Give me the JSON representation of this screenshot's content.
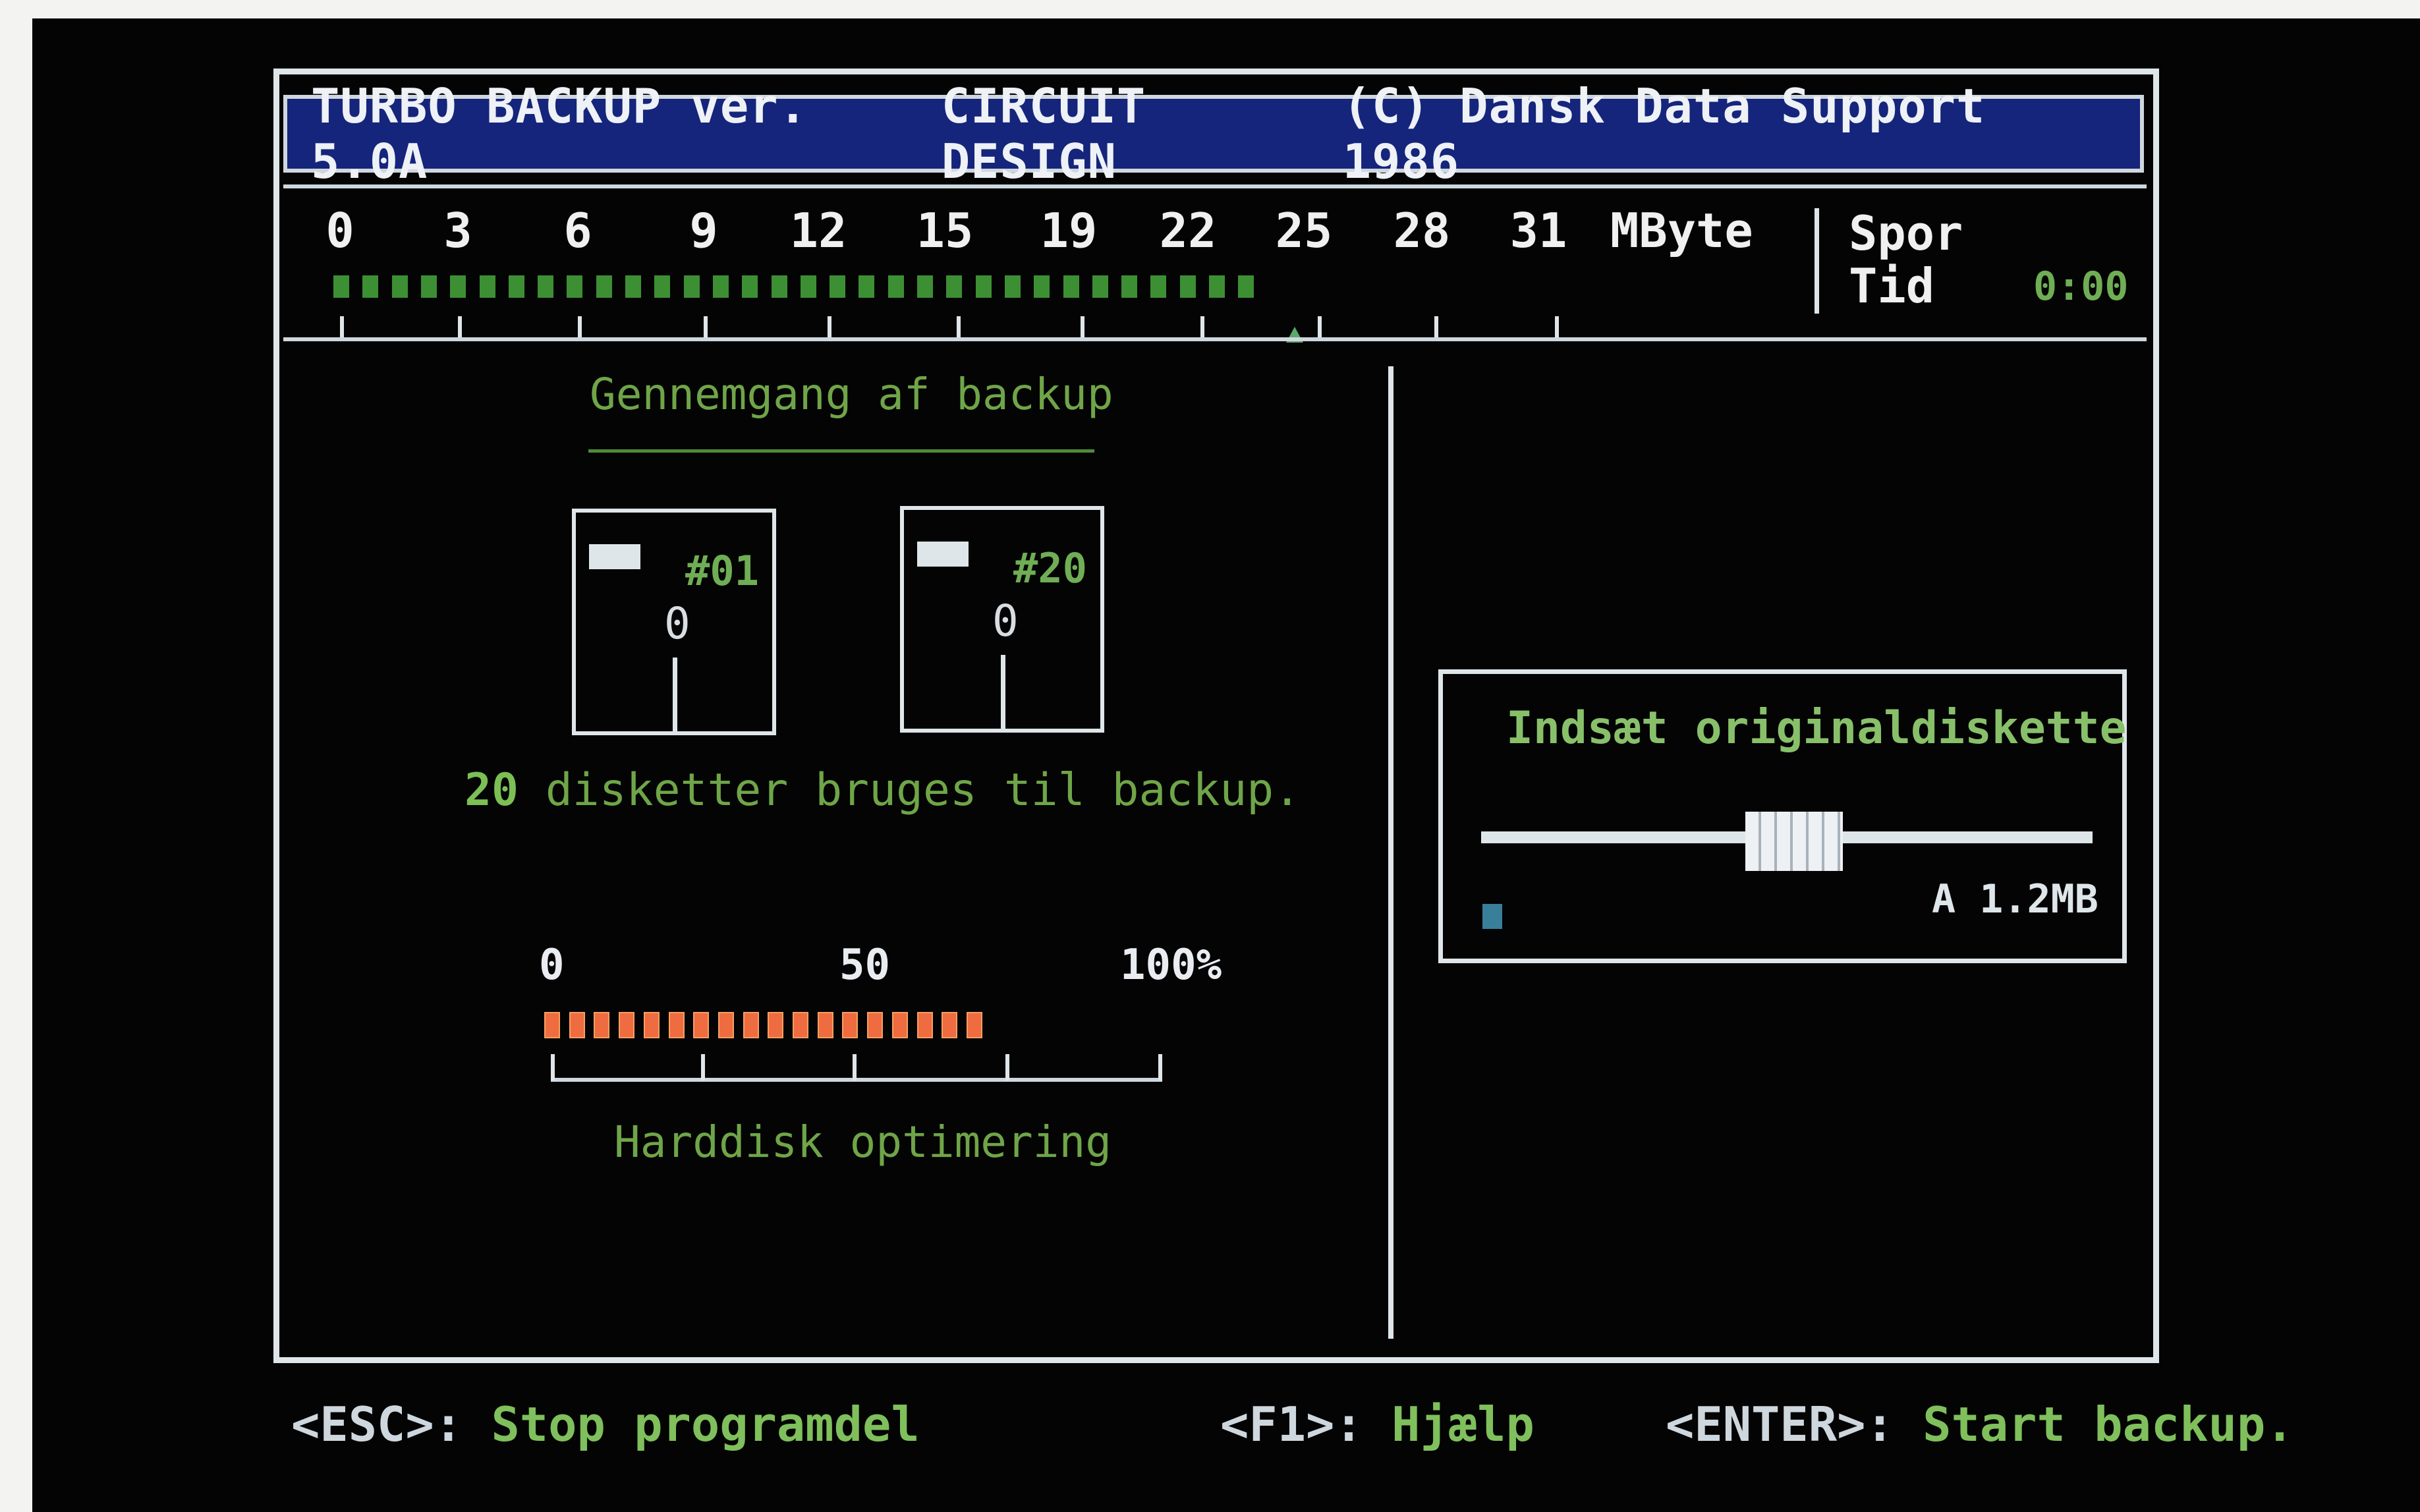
{
  "title_bar": {
    "left": "TURBO BACKUP ver. 5.0A",
    "center": "CIRCUIT DESIGN",
    "right": "(C) Dansk Data Support 1986"
  },
  "mbyte_scale": {
    "labels": [
      "0",
      "3",
      "6",
      "9",
      "12",
      "15",
      "19",
      "22",
      "25",
      "28",
      "31"
    ],
    "unit": "MByte",
    "filled_segments": 32,
    "spor_label": "Spor",
    "tid_label": "Tid",
    "tid_value": "0:00"
  },
  "left_panel": {
    "heading": "Gennemgang af backup",
    "disks": [
      {
        "number": "#01",
        "value": "0"
      },
      {
        "number": "#20",
        "value": "0"
      }
    ],
    "disketter_count": "20",
    "disketter_text": "disketter bruges til backup.",
    "progress": {
      "labels": [
        "0",
        "50",
        "100%"
      ],
      "fraction": 0.7,
      "caption": "Harddisk optimering"
    }
  },
  "dialog": {
    "title": "Indsæt originaldiskette",
    "drive": "A 1.2MB"
  },
  "footer": {
    "esc_key": "<ESC>:",
    "esc_text": "Stop programdel",
    "f1_key": "<F1>:",
    "f1_text": "Hjælp",
    "enter_key": "<ENTER>:",
    "enter_text": "Start backup."
  },
  "colors": {
    "title_bg": "#15257c",
    "green": "#6fa548",
    "orange": "#ef6b40",
    "frame": "#dfe6ea"
  }
}
